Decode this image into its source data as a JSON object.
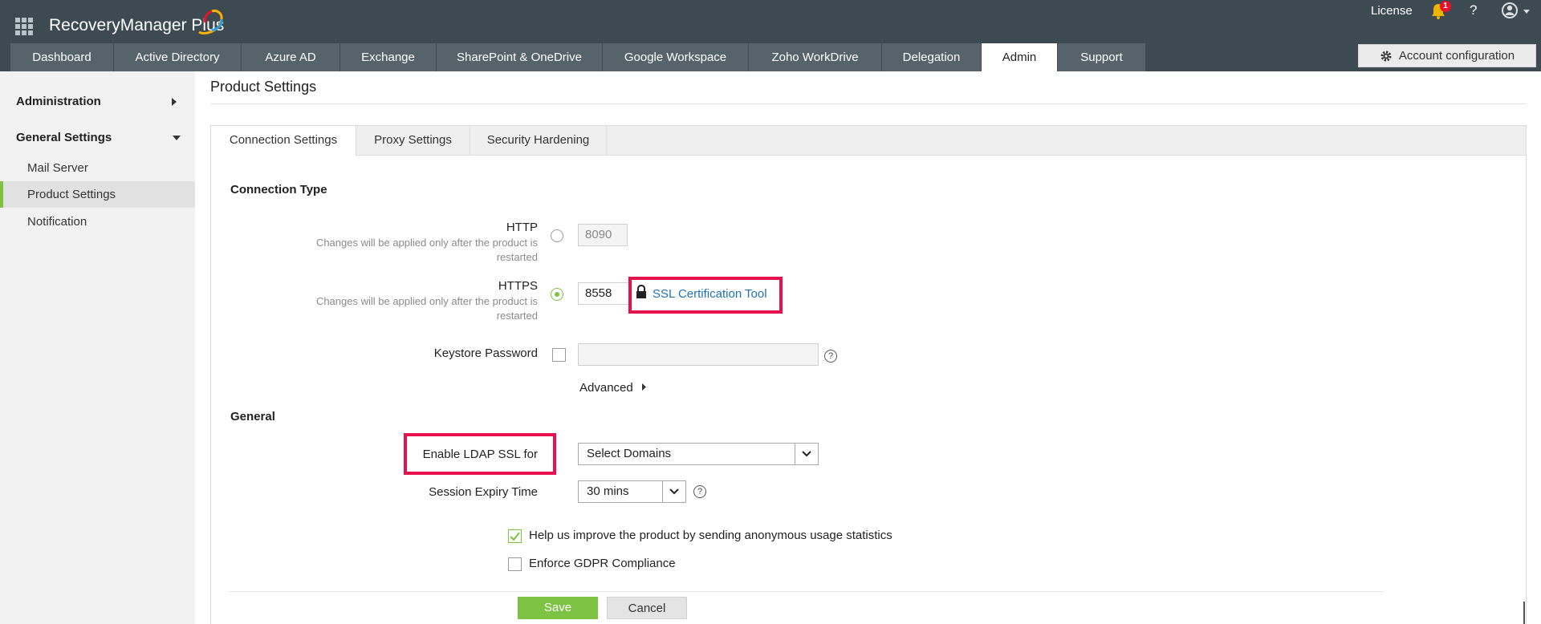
{
  "app": {
    "title": "RecoveryManager Plus"
  },
  "header": {
    "license_label": "License",
    "notification_count": "1",
    "help_label": "?",
    "account_config_label": "Account configuration"
  },
  "nav": {
    "tabs": [
      {
        "label": "Dashboard"
      },
      {
        "label": "Active Directory"
      },
      {
        "label": "Azure AD"
      },
      {
        "label": "Exchange"
      },
      {
        "label": "SharePoint & OneDrive"
      },
      {
        "label": "Google Workspace"
      },
      {
        "label": "Zoho WorkDrive"
      },
      {
        "label": "Delegation"
      },
      {
        "label": "Admin"
      },
      {
        "label": "Support"
      }
    ],
    "active_tab": "Admin"
  },
  "sidebar": {
    "administration": "Administration",
    "general_settings": "General Settings",
    "items": [
      {
        "label": "Mail Server"
      },
      {
        "label": "Product Settings"
      },
      {
        "label": "Notification"
      }
    ],
    "active_item": "Product Settings"
  },
  "main": {
    "page_title": "Product Settings",
    "subtabs": [
      {
        "label": "Connection Settings"
      },
      {
        "label": "Proxy Settings"
      },
      {
        "label": "Security Hardening"
      }
    ],
    "connection_type_heading": "Connection Type",
    "http": {
      "label": "HTTP",
      "hint_line1": "Changes will be applied only after the product is",
      "hint_line2": "restarted",
      "port": "8090",
      "selected": false
    },
    "https": {
      "label": "HTTPS",
      "hint_line1": "Changes will be applied only after the product is",
      "hint_line2": "restarted",
      "port": "8558",
      "selected": true,
      "ssl_tool_label": "SSL Certification Tool"
    },
    "keystore_label": "Keystore Password",
    "keystore_value": "",
    "advanced_label": "Advanced",
    "general_heading": "General",
    "ldap_ssl_label": "Enable LDAP SSL for",
    "ldap_ssl_value": "Select Domains",
    "session_expiry_label": "Session Expiry Time",
    "session_expiry_value": "30 mins",
    "usage_stats_label": "Help us improve the product by sending anonymous usage statistics",
    "usage_stats_checked": true,
    "gdpr_label": "Enforce GDPR Compliance",
    "gdpr_checked": false,
    "save_label": "Save",
    "cancel_label": "Cancel"
  },
  "colors": {
    "header_bg": "#3e4a52",
    "tab_bg": "#56636b",
    "accent_green": "#7cc243",
    "highlight_red": "#e7124d",
    "link_blue": "#1f72b8"
  }
}
